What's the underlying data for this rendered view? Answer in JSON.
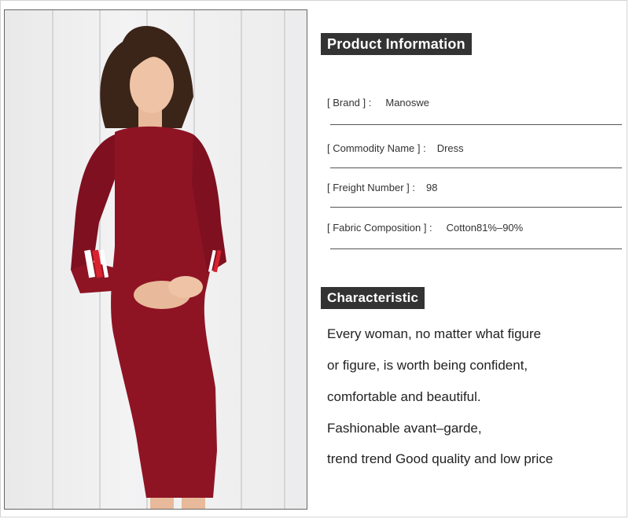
{
  "product_info": {
    "title": "Product Information",
    "rows": [
      {
        "label": "[ Brand ] :",
        "value": "Manoswe"
      },
      {
        "label": "[ Commodity Name ] :",
        "value": "Dress"
      },
      {
        "label": "[ Freight Number ] :",
        "value": "98"
      },
      {
        "label": "[ Fabric Composition ] :",
        "value": "Cotton81%–90%"
      }
    ]
  },
  "characteristic": {
    "title": "Characteristic",
    "lines": [
      "Every woman, no matter what figure",
      "or figure, is worth being confident,",
      "comfortable and beautiful.",
      "Fashionable avant–garde,",
      "trend trend Good quality and low price"
    ]
  },
  "colors": {
    "dress": "#8e1424",
    "heading_bg": "#333333"
  }
}
